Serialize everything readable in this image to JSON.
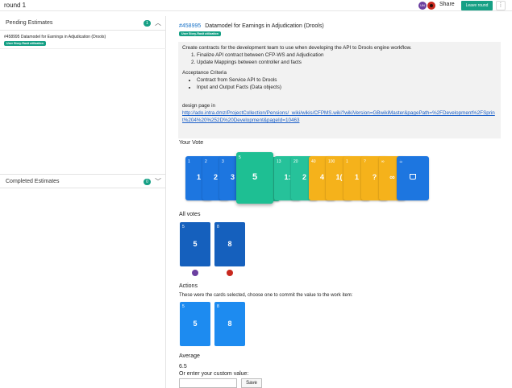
{
  "header": {
    "round_title": "round 1",
    "share_label": "Share",
    "leave_label": "Leave round",
    "more_icon": "vertical-ellipsis-icon",
    "user_initials": "UN"
  },
  "sidebar": {
    "pending": {
      "title": "Pending Estimates",
      "count": "1",
      "items": [
        {
          "title": "#458995 Datamodel for Earnings in Adjudication (Drools)",
          "tag": "User Story-Rasit utilization"
        }
      ]
    },
    "completed": {
      "title": "Completed Estimates",
      "count": "0"
    }
  },
  "work_item": {
    "id": "#458995",
    "title": "Datamodel for Earnings in Adjudication (Drools)",
    "tag": "User Story-Rasit utilization",
    "description": {
      "intro": "Create contracts for the development team to use when developing the API to Drools engine workflow.",
      "steps": [
        "Finalize API contract between CFP-WS and Adjudication",
        "Update Mappings between controller and facts"
      ],
      "criteria_title": "Acceptance Criteria",
      "criteria": [
        "Contract from Service API to Drools",
        "Input and Output Facts (Data objects)"
      ],
      "design_label": "design page in",
      "link": "http://ado.intra.dmz/ProjectCollection/Pensions/_wiki/wikis/CFPMS.wiki?wikiVersion=GBwikiMaster&pagePath=%2FDevelopment%2FSprint%204%20%252D%20Development&pageId=10463"
    }
  },
  "vote": {
    "label": "Your Vote",
    "cards": [
      {
        "corner": "1",
        "center": "1",
        "color": "blue"
      },
      {
        "corner": "2",
        "center": "2",
        "color": "blue"
      },
      {
        "corner": "3",
        "center": "3",
        "color": "blue"
      },
      {
        "corner": "5",
        "center": "5",
        "color": "selected"
      },
      {
        "corner": "8",
        "center": "8",
        "color": "green"
      },
      {
        "corner": "13",
        "center": "1:",
        "color": "green"
      },
      {
        "corner": "20",
        "center": "2",
        "color": "green"
      },
      {
        "corner": "40",
        "center": "4",
        "color": "orange"
      },
      {
        "corner": "100",
        "center": "1(",
        "color": "orange"
      },
      {
        "corner": "1",
        "center": "1",
        "color": "orange"
      },
      {
        "corner": "?",
        "center": "?",
        "color": "orange"
      },
      {
        "corner": "∞",
        "center": "∞",
        "color": "orange"
      },
      {
        "corner": "☕",
        "center": "",
        "color": "blue"
      }
    ]
  },
  "all_votes": {
    "label": "All votes",
    "cards": [
      {
        "corner": "5",
        "center": "5"
      },
      {
        "corner": "8",
        "center": "8"
      }
    ]
  },
  "actions": {
    "label": "Actions",
    "instruction": "These were the cards selected, choose one to commit the value to the work item:",
    "cards": [
      {
        "corner": "5",
        "center": "5"
      },
      {
        "corner": "8",
        "center": "8"
      }
    ]
  },
  "average": {
    "label": "Average",
    "value": "6.5",
    "custom_label": "Or enter your custom value:",
    "custom_value": "",
    "save_label": "Save"
  },
  "colors": {
    "accent": "#16a085",
    "card_blue": "#1d76e0",
    "card_orange": "#f5b21b",
    "card_green": "#26c29a",
    "link": "#1a5fc8"
  }
}
